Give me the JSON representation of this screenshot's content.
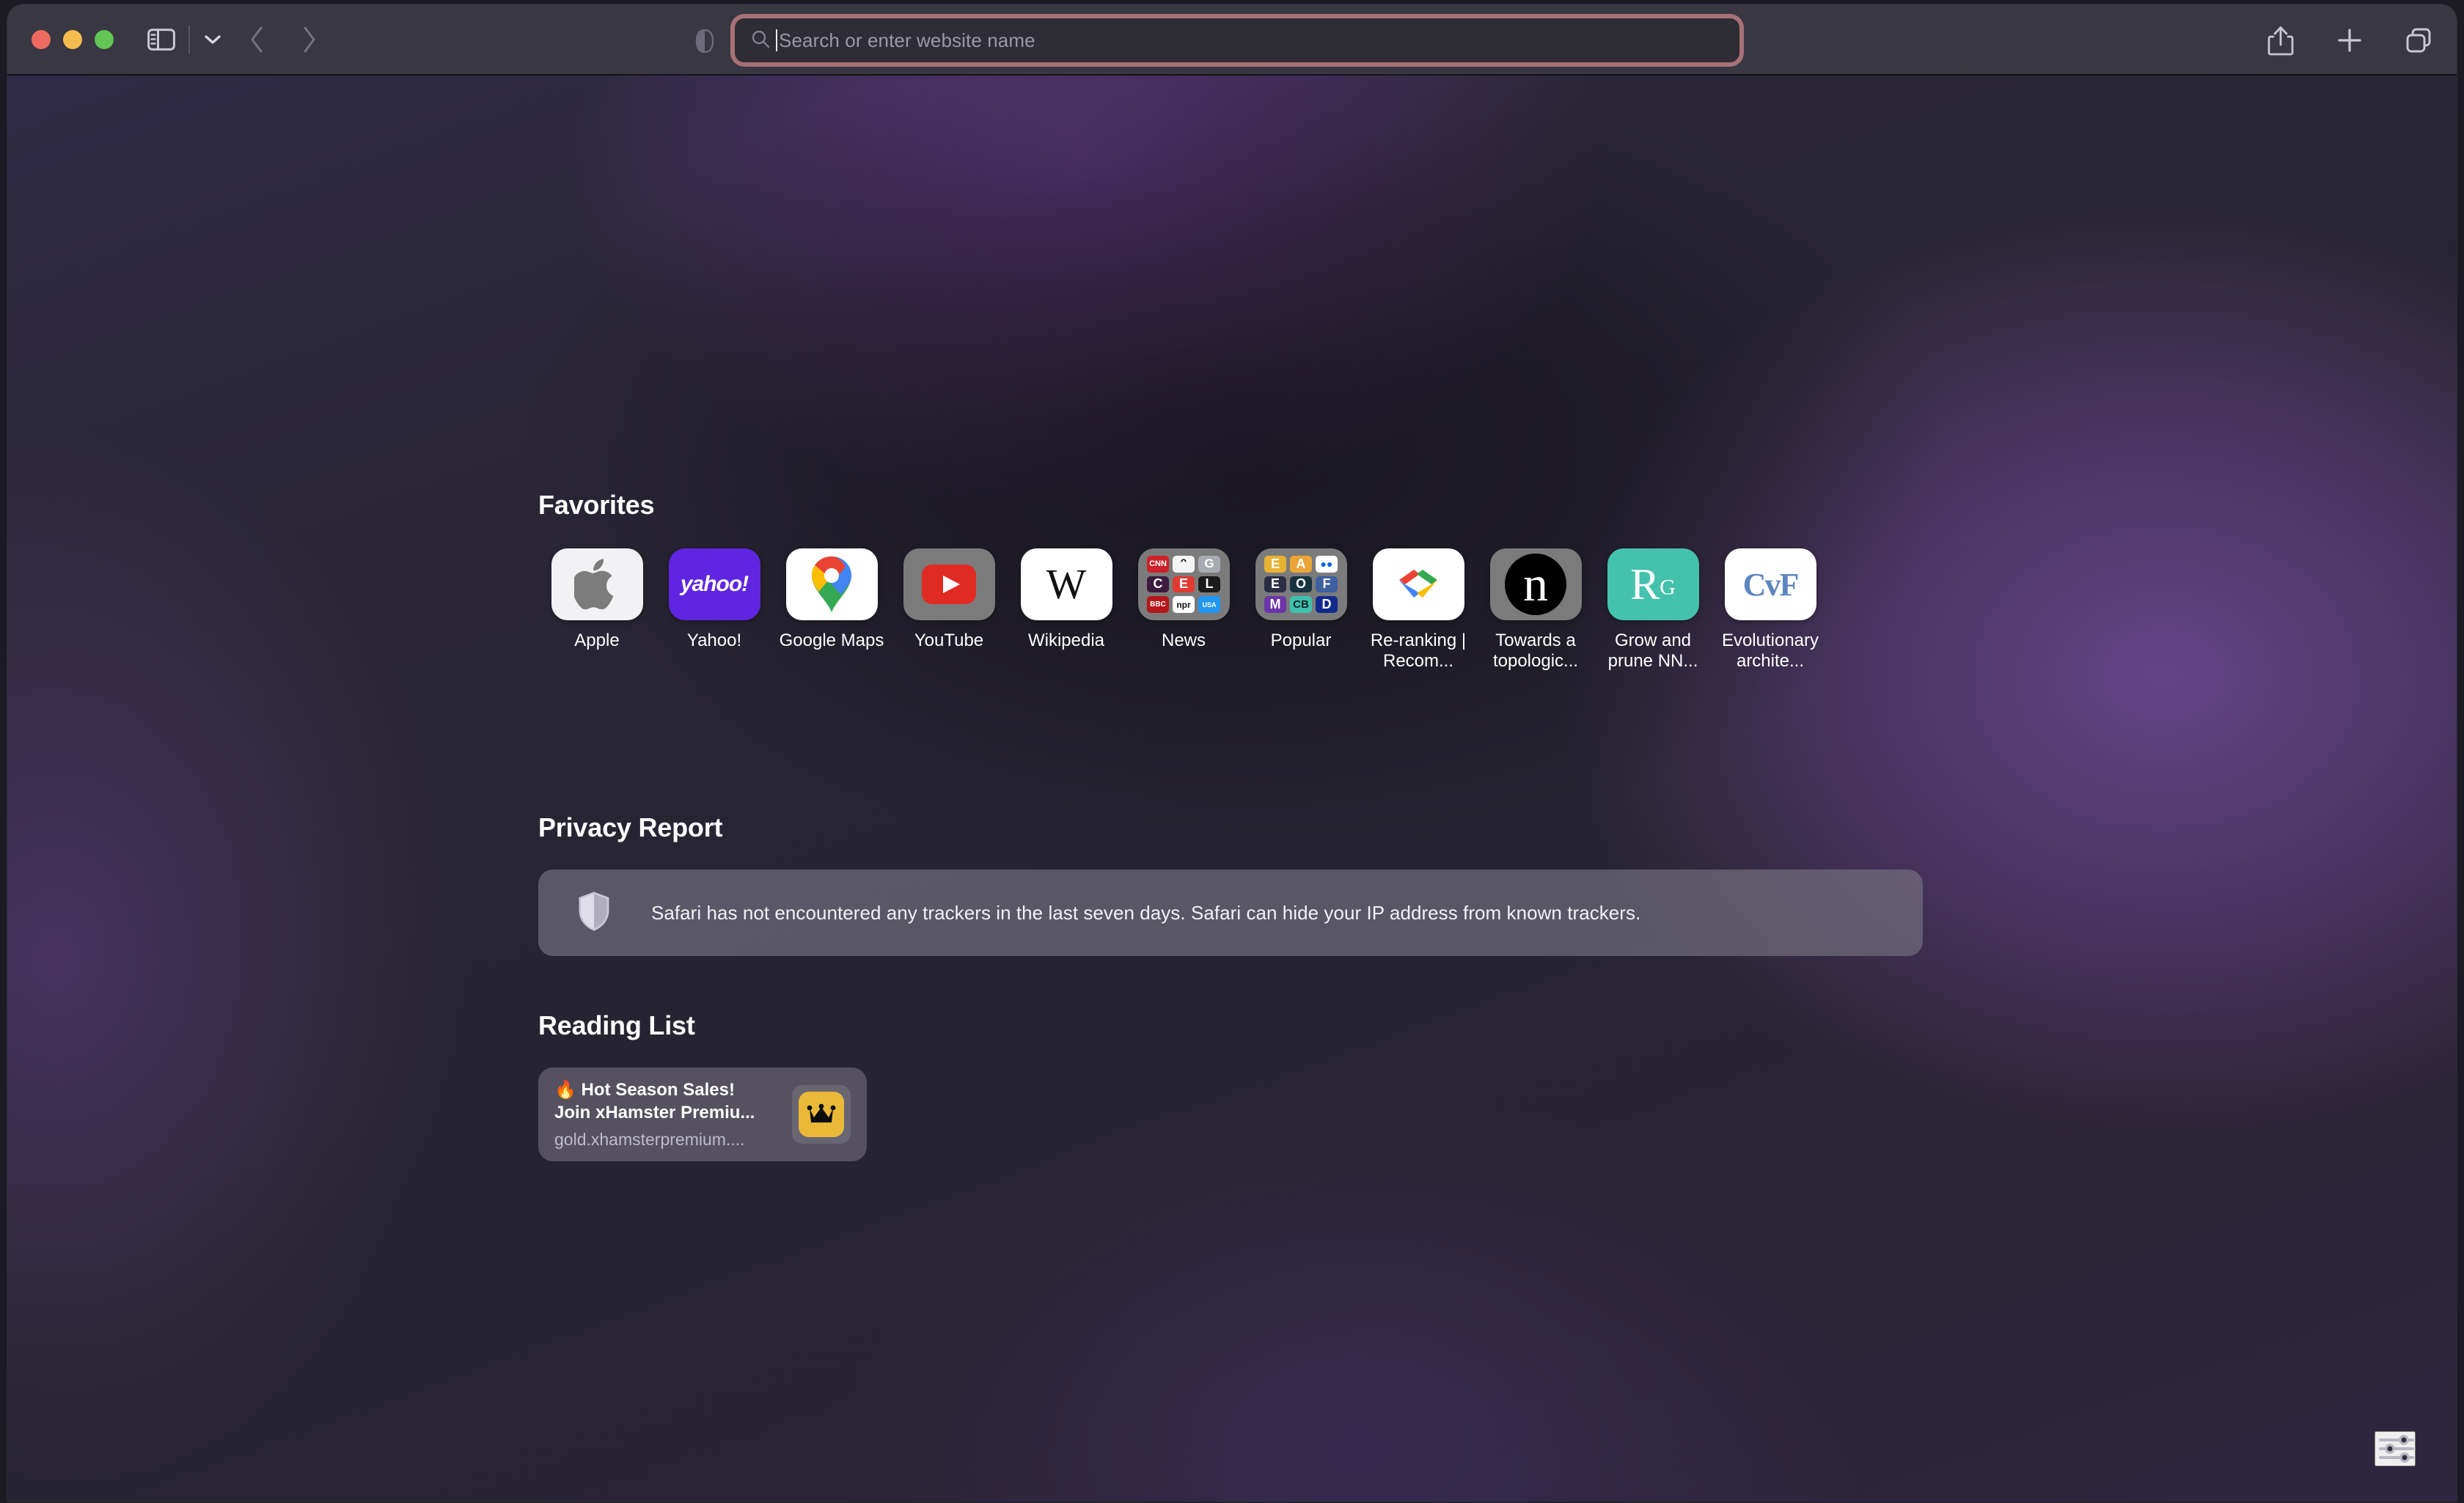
{
  "window": {
    "traffic_lights": [
      "close",
      "minimize",
      "maximize"
    ],
    "colors": {
      "close": "#ec6a5f",
      "minimize": "#f4bd50",
      "maximize": "#62c554",
      "toolbar_bg": "#393742",
      "focus_ring": "#c17e82",
      "page_accent_purple": "#704896"
    }
  },
  "toolbar": {
    "sidebar_toggle_label": "Sidebar",
    "tab_overview_chevron_label": "Tab Group Menu",
    "back_label": "Back",
    "forward_label": "Forward",
    "share_label": "Share",
    "new_tab_label": "New Tab",
    "tab_overview_label": "Tab Overview",
    "reader_label": "Reader"
  },
  "search": {
    "placeholder": "Search or enter website name",
    "value": "",
    "icon": "search-icon",
    "focused": true
  },
  "favorites": {
    "title": "Favorites",
    "items": [
      {
        "label": "Apple",
        "kind": "apple",
        "bg": "#f2f2f4"
      },
      {
        "label": "Yahoo!",
        "kind": "yahoo",
        "bg": "#5f25e0",
        "text": "yahoo!"
      },
      {
        "label": "Google Maps",
        "kind": "gmaps",
        "bg": "#ffffff"
      },
      {
        "label": "YouTube",
        "kind": "youtube",
        "bg": "#7b7b7b"
      },
      {
        "label": "Wikipedia",
        "kind": "wiki",
        "bg": "#ffffff",
        "text": "W"
      },
      {
        "label": "News",
        "kind": "folder",
        "bg": "#7b7b7b",
        "cells": [
          {
            "text": "CNN",
            "bg": "#cc2229",
            "fg": "#ffffff",
            "size": 11
          },
          {
            "text": "ᵔ",
            "bg": "#f4f4f4",
            "fg": "#111111",
            "size": 20
          },
          {
            "text": "G",
            "bg": "#a9abb2",
            "fg": "#ffffff",
            "size": 17
          },
          {
            "text": "C",
            "bg": "#3c1b3e",
            "fg": "#ffffff",
            "size": 18
          },
          {
            "text": "E",
            "bg": "#e03a33",
            "fg": "#ffffff",
            "size": 18
          },
          {
            "text": "L",
            "bg": "#1b1b1b",
            "fg": "#ffffff",
            "size": 18
          },
          {
            "text": "BBC",
            "bg": "#b4161b",
            "fg": "#ffffff",
            "size": 10
          },
          {
            "text": "npr",
            "bg": "#ffffff",
            "fg": "#111111",
            "size": 12
          },
          {
            "text": "USA",
            "bg": "#2196f3",
            "fg": "#ffffff",
            "size": 9
          }
        ]
      },
      {
        "label": "Popular",
        "kind": "folder",
        "bg": "#7b7b7b",
        "cells": [
          {
            "text": "E",
            "bg": "#e8b234",
            "fg": "#ffffff",
            "size": 18
          },
          {
            "text": "A",
            "bg": "#eba536",
            "fg": "#ffffff",
            "size": 18
          },
          {
            "text": "●●",
            "bg": "#ffffff",
            "fg": "#0063dc",
            "size": 14
          },
          {
            "text": "E",
            "bg": "#2b2d45",
            "fg": "#ffffff",
            "size": 18
          },
          {
            "text": "O",
            "bg": "#16333e",
            "fg": "#ffffff",
            "size": 18
          },
          {
            "text": "F",
            "bg": "#3e5fa0",
            "fg": "#ffffff",
            "size": 18
          },
          {
            "text": "M",
            "bg": "#6c35a8",
            "fg": "#ffffff",
            "size": 18
          },
          {
            "text": "CB",
            "bg": "#3fc2ad",
            "fg": "#10232b",
            "size": 15
          },
          {
            "text": "D",
            "bg": "#112a8e",
            "fg": "#ffffff",
            "size": 18
          }
        ]
      },
      {
        "label": "Re-ranking | Recom...",
        "kind": "gdev",
        "bg": "#ffffff"
      },
      {
        "label": "Towards a topologic...",
        "kind": "nature",
        "bg": "#7b7b7b",
        "text": "n"
      },
      {
        "label": "Grow and prune NN...",
        "kind": "rgate",
        "bg": "#44c2ad",
        "text": "R"
      },
      {
        "label": "Evolutionary archite...",
        "kind": "cvf",
        "bg": "#ffffff",
        "text": "CvF"
      }
    ]
  },
  "privacy_report": {
    "title": "Privacy Report",
    "icon": "shield-icon",
    "message": "Safari has not encountered any trackers in the last seven days. Safari can hide your IP address from known trackers."
  },
  "reading_list": {
    "title": "Reading List",
    "items": [
      {
        "title_line1": "🔥 Hot Season Sales!",
        "title_line2": "Join xHamster Premiu...",
        "url": "gold.xhamsterpremium....",
        "thumbnail": "crown-icon"
      }
    ]
  },
  "customize": {
    "label": "Customize Start Page",
    "icon": "sliders-icon"
  }
}
